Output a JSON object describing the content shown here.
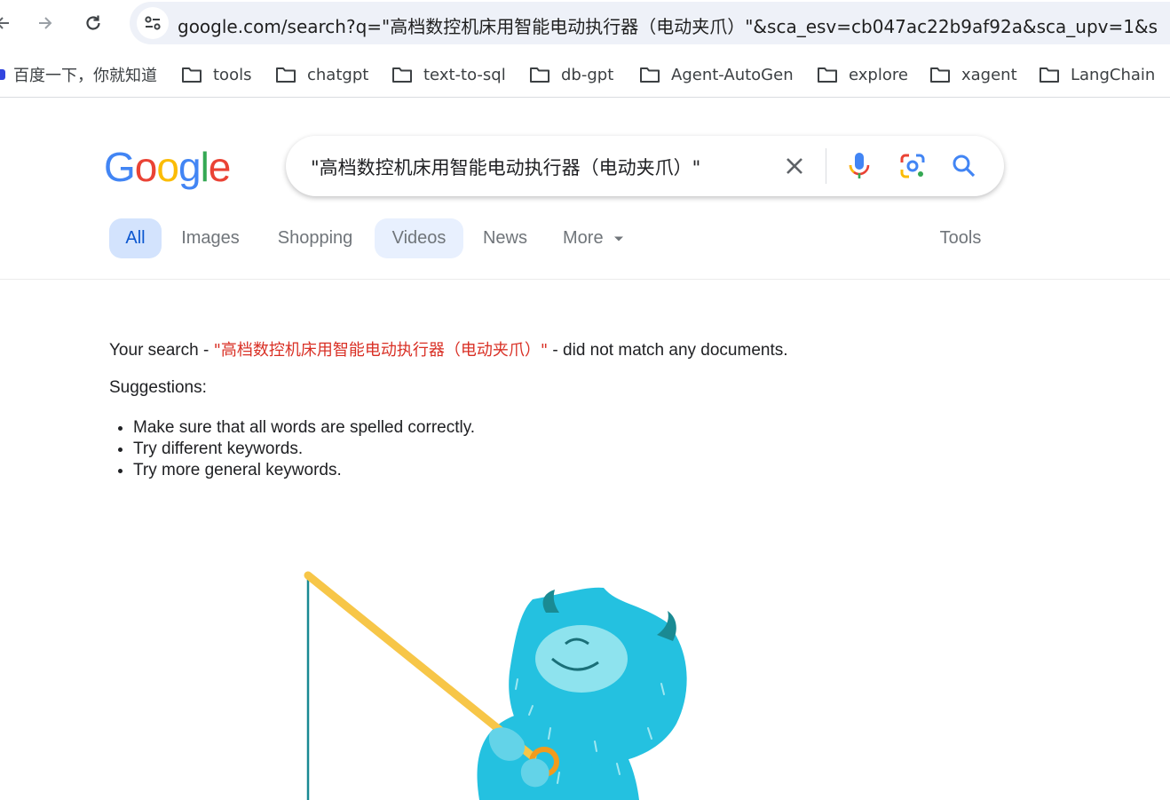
{
  "browser": {
    "url": "google.com/search?q=\"高档数控机床用智能电动执行器（电动夹爪）\"&sca_esv=cb047ac22b9af92a&sca_upv=1&s",
    "bookmarks": [
      {
        "label": "百度一下，你就知道",
        "icon": "baidu-icon"
      },
      {
        "label": "tools",
        "icon": "folder-icon"
      },
      {
        "label": "chatgpt",
        "icon": "folder-icon"
      },
      {
        "label": "text-to-sql",
        "icon": "folder-icon"
      },
      {
        "label": "db-gpt",
        "icon": "folder-icon"
      },
      {
        "label": "Agent-AutoGen",
        "icon": "folder-icon"
      },
      {
        "label": "explore",
        "icon": "folder-icon"
      },
      {
        "label": "xagent",
        "icon": "folder-icon"
      },
      {
        "label": "LangChain",
        "icon": "folder-icon"
      }
    ]
  },
  "google": {
    "logo": [
      "G",
      "o",
      "o",
      "g",
      "l",
      "e"
    ],
    "search_value": "\"高档数控机床用智能电动执行器（电动夹爪）\"",
    "tabs": [
      {
        "label": "All",
        "state": "active"
      },
      {
        "label": "Images",
        "state": "normal"
      },
      {
        "label": "Shopping",
        "state": "normal"
      },
      {
        "label": "Videos",
        "state": "highlight"
      },
      {
        "label": "News",
        "state": "normal"
      },
      {
        "label": "More",
        "state": "normal"
      }
    ],
    "tools_label": "Tools"
  },
  "results": {
    "prefix": "Your search - ",
    "query": "\"高档数控机床用智能电动执行器（电动夹爪）\"",
    "suffix": " - did not match any documents.",
    "suggestions_title": "Suggestions:",
    "suggestions": [
      "Make sure that all words are spelled correctly.",
      "Try different keywords.",
      "Try more general keywords."
    ]
  },
  "colors": {
    "accent_blue": "#0b57d0",
    "query_red": "#d93025",
    "active_tab_bg": "#d3e3fd",
    "mascot": "#24c1e0"
  }
}
